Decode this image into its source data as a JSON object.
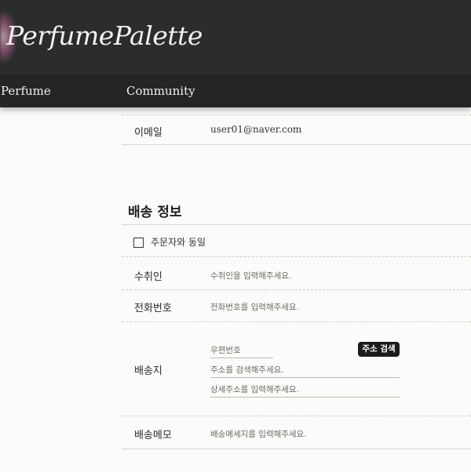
{
  "header": {
    "logo_text": "PerfumePalette"
  },
  "nav": {
    "items": [
      {
        "label": "Perfume"
      },
      {
        "label": "Community"
      }
    ]
  },
  "orderer": {
    "email_label": "이메일",
    "email_value": "user01@naver.com"
  },
  "shipping": {
    "title": "배송 정보",
    "same_as_orderer_label": "주문자와 동일",
    "recipient": {
      "label": "수취인",
      "placeholder": "수취인을 입력해주세요."
    },
    "phone": {
      "label": "전화번호",
      "placeholder": "전화번호를 입력해주세요."
    },
    "address": {
      "label": "배송지",
      "zipcode_placeholder": "우편번호",
      "search_button": "주소 검색",
      "address_placeholder": "주소를 검색해주세요.",
      "detail_placeholder": "상세주소를 입력해주세요."
    },
    "memo": {
      "label": "배송메모",
      "placeholder": "배송메세지를 입력해주세요."
    }
  }
}
